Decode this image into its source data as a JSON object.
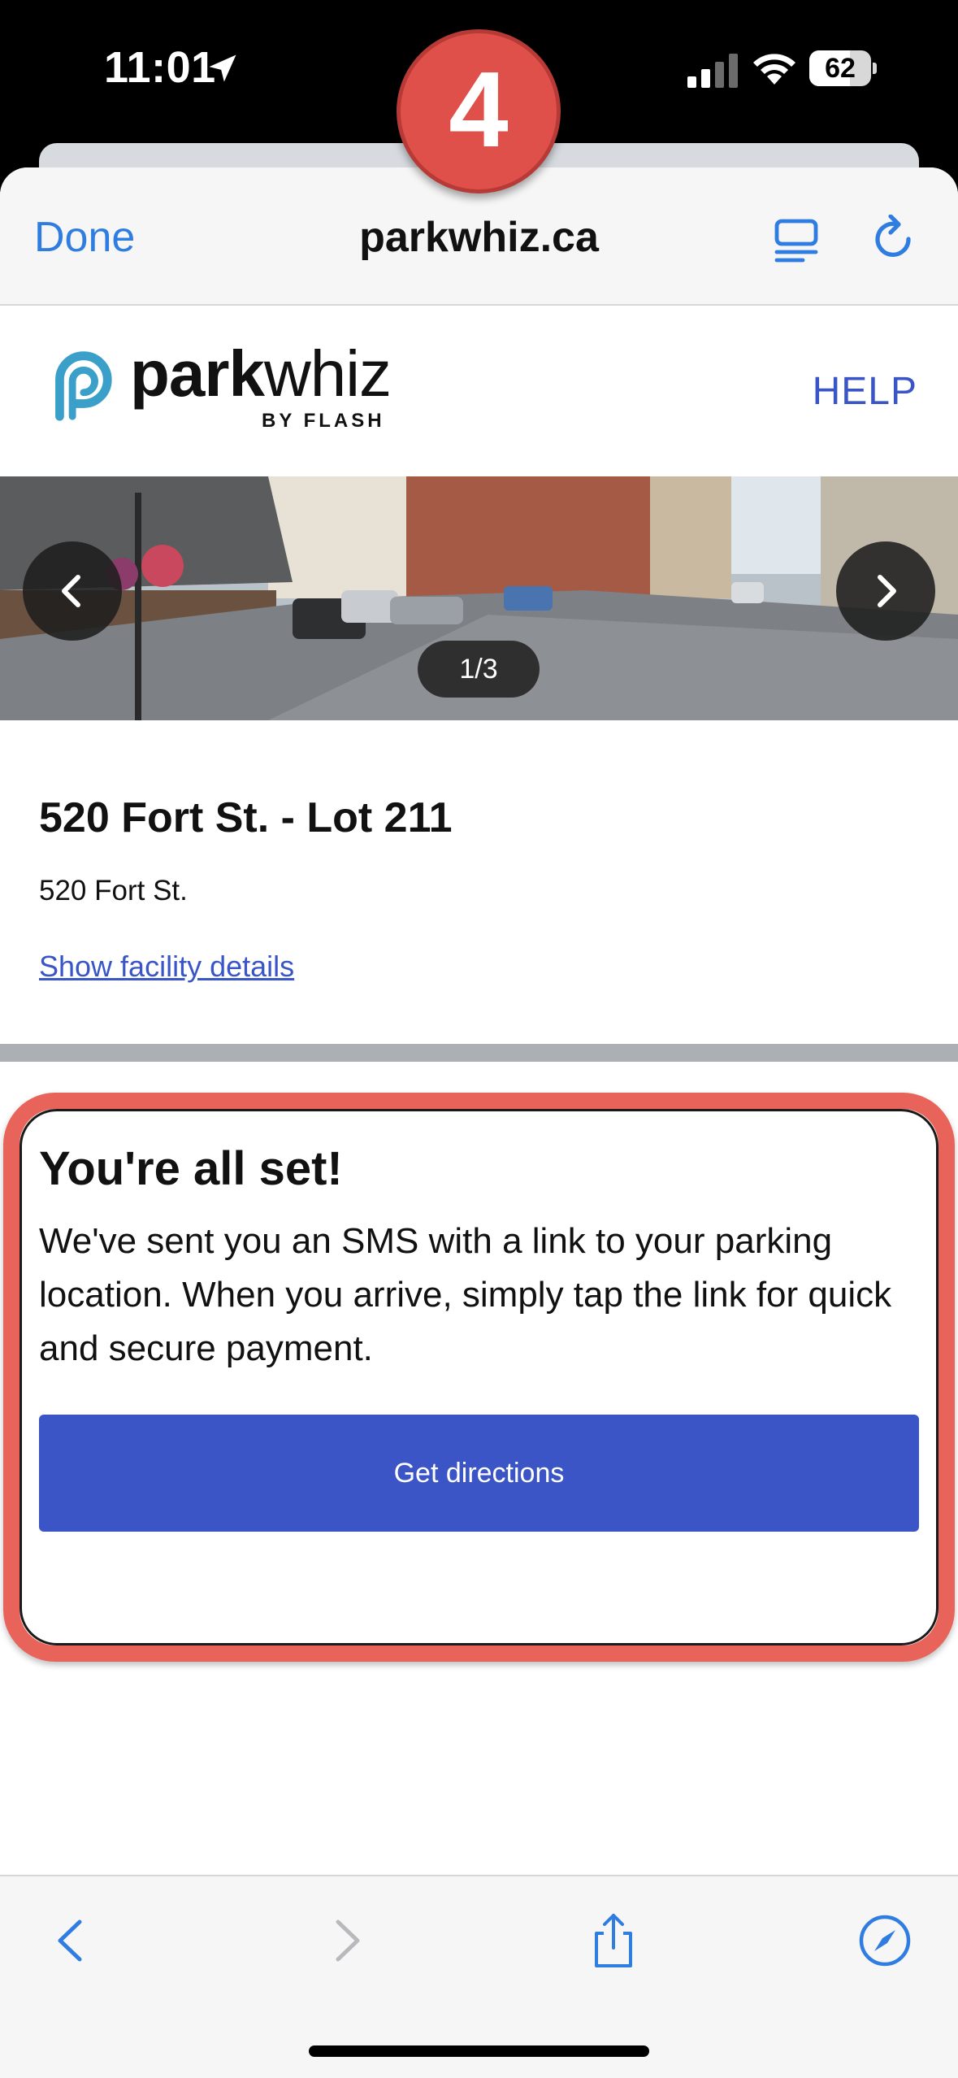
{
  "status_bar": {
    "time": "11:01",
    "battery": "62"
  },
  "step_badge": "4",
  "browser": {
    "done_label": "Done",
    "url": "parkwhiz.ca"
  },
  "site": {
    "logo_bold": "park",
    "logo_light": "whiz",
    "logo_sub": "BY FLASH",
    "help_label": "HELP"
  },
  "carousel": {
    "counter": "1/3"
  },
  "lot": {
    "title": "520 Fort St. - Lot 211",
    "address": "520 Fort St.",
    "details_link": "Show facility details"
  },
  "confirmation": {
    "title": "You're all set!",
    "message": "We've sent you an SMS with a link to your parking location. When you arrive, simply tap the link for quick and secure payment.",
    "button_label": "Get directions"
  },
  "colors": {
    "link_blue": "#2f7de1",
    "brand_blue": "#3c55c6",
    "badge_red": "#e0504b",
    "highlight_red": "#e8635a"
  },
  "icons": {
    "status": [
      "location-arrow-icon",
      "signal-icon",
      "wifi-icon",
      "battery-icon"
    ],
    "browser": [
      "reader-view-icon",
      "reload-icon"
    ],
    "toolbar": [
      "back-icon",
      "forward-icon",
      "share-icon",
      "compass-icon"
    ]
  }
}
